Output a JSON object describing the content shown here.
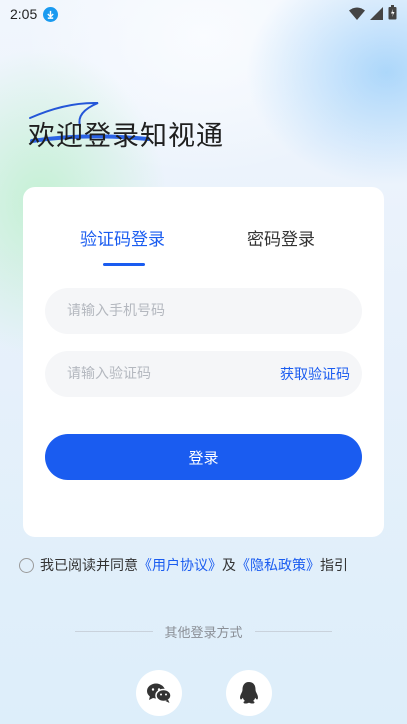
{
  "status_bar": {
    "time": "2:05",
    "icons": [
      "download-icon",
      "wifi-icon",
      "signal-icon",
      "battery-icon"
    ]
  },
  "welcome": {
    "title": "欢迎登录知视通"
  },
  "login_card": {
    "tabs": [
      {
        "label": "验证码登录",
        "active": true
      },
      {
        "label": "密码登录",
        "active": false
      }
    ],
    "phone_field": {
      "placeholder": "请输入手机号码",
      "value": ""
    },
    "code_field": {
      "placeholder": "请输入验证码",
      "value": ""
    },
    "get_code_label": "获取验证码",
    "submit_label": "登录"
  },
  "agreement": {
    "prefix": "我已阅读并同意",
    "user_agreement": "《用户协议》",
    "and": "及",
    "privacy_policy": "《隐私政策》",
    "suffix": "指引",
    "checked": false
  },
  "other_login": {
    "label": "其他登录方式",
    "methods": [
      {
        "icon": "wechat-icon"
      },
      {
        "icon": "qq-icon"
      }
    ]
  },
  "colors": {
    "accent": "#1a5cf0",
    "text": "#333333",
    "placeholder": "#b4b8bf"
  }
}
